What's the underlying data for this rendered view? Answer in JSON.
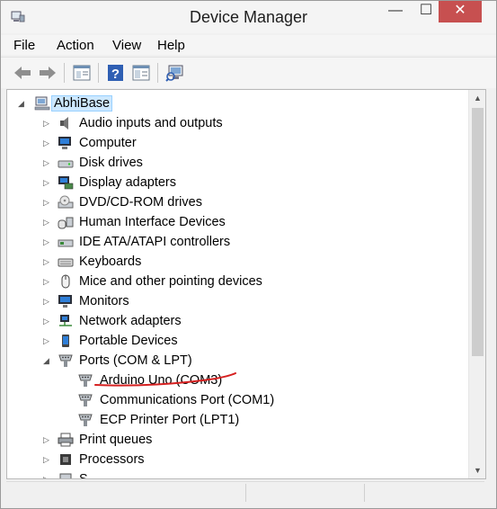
{
  "window": {
    "title": "Device Manager",
    "controls": {
      "minimize": "—",
      "maximize": "☐",
      "close": "✕"
    }
  },
  "menu": {
    "items": [
      {
        "label": "File"
      },
      {
        "label": "Action"
      },
      {
        "label": "View"
      },
      {
        "label": "Help"
      }
    ]
  },
  "toolbar": {
    "buttons": [
      {
        "icon": "back-arrow-icon"
      },
      {
        "icon": "forward-arrow-icon"
      },
      {
        "icon": "properties-icon"
      },
      {
        "icon": "help-icon"
      },
      {
        "icon": "console-view-icon"
      },
      {
        "icon": "scan-hardware-icon"
      }
    ]
  },
  "tree": {
    "root": {
      "label": "AbhiBase",
      "expanded": true,
      "selected": true,
      "icon": "computer-root-icon"
    },
    "nodes": [
      {
        "label": "Audio inputs and outputs",
        "icon": "speaker-icon",
        "expanded": false
      },
      {
        "label": "Computer",
        "icon": "monitor-icon",
        "expanded": false
      },
      {
        "label": "Disk drives",
        "icon": "disk-drive-icon",
        "expanded": false
      },
      {
        "label": "Display adapters",
        "icon": "display-adapter-icon",
        "expanded": false
      },
      {
        "label": "DVD/CD-ROM drives",
        "icon": "dvd-drive-icon",
        "expanded": false
      },
      {
        "label": "Human Interface Devices",
        "icon": "hid-icon",
        "expanded": false
      },
      {
        "label": "IDE ATA/ATAPI controllers",
        "icon": "ide-controller-icon",
        "expanded": false
      },
      {
        "label": "Keyboards",
        "icon": "keyboard-icon",
        "expanded": false
      },
      {
        "label": "Mice and other pointing devices",
        "icon": "mouse-icon",
        "expanded": false
      },
      {
        "label": "Monitors",
        "icon": "monitor-icon",
        "expanded": false
      },
      {
        "label": "Network adapters",
        "icon": "network-adapter-icon",
        "expanded": false
      },
      {
        "label": "Portable Devices",
        "icon": "portable-device-icon",
        "expanded": false
      },
      {
        "label": "Ports (COM & LPT)",
        "icon": "port-icon",
        "expanded": true,
        "children": [
          {
            "label": "Arduino Uno (COM3)",
            "icon": "port-icon",
            "underlined": true
          },
          {
            "label": "Communications Port (COM1)",
            "icon": "port-icon"
          },
          {
            "label": "ECP Printer Port (LPT1)",
            "icon": "port-icon"
          }
        ]
      },
      {
        "label": "Print queues",
        "icon": "printer-icon",
        "expanded": false
      },
      {
        "label": "Processors",
        "icon": "processor-icon",
        "expanded": false
      },
      {
        "label": "S...",
        "icon": "generic-device-icon",
        "expanded": false
      }
    ]
  },
  "annotation_color": "#d62020"
}
